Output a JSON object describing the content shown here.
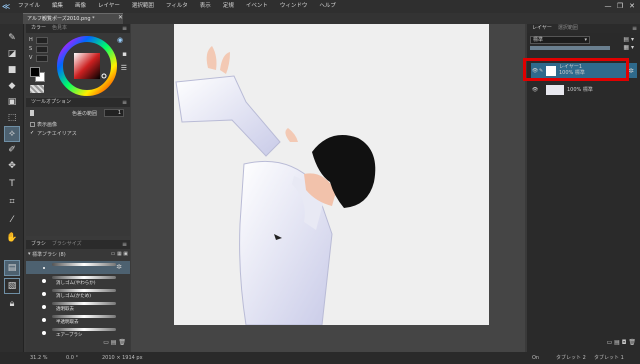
{
  "menu": {
    "items": [
      "ファイル",
      "編集",
      "画像",
      "レイヤー",
      "選択範囲",
      "フィルタ",
      "表示",
      "定規",
      "イベント",
      "ウィンドウ",
      "ヘルプ"
    ],
    "window_controls": [
      "—",
      "❐",
      "✕"
    ]
  },
  "document": {
    "tab_title": "アルフ観覧ポーズ2010.png *"
  },
  "color_panel": {
    "tabs": [
      "カラー",
      "色見本"
    ],
    "labels": [
      "H",
      "S",
      "V"
    ]
  },
  "tool_options": {
    "title": "ツールオプション",
    "tolerance_label": "色差の範囲",
    "tolerance_value": "1",
    "checkboxes": [
      {
        "label": "表示画像",
        "checked": false
      },
      {
        "label": "アンチエイリアス",
        "checked": true
      }
    ]
  },
  "brush_panel": {
    "tabs": [
      "ブラシ",
      "ブラシサイズ"
    ],
    "group_label": "標準ブラシ (8)",
    "brushes": [
      "",
      "消しゴム(やわらか)",
      "消しゴム(かため)",
      "透明取去",
      "半透明取去",
      "エアーブラシ"
    ]
  },
  "layers_panel": {
    "tabs": [
      "レイヤー",
      "選択範囲"
    ],
    "blend_mode": "標準",
    "layers": [
      {
        "name": "レイヤー1",
        "info": "100% 標準",
        "selected": true
      },
      {
        "name": "",
        "info": "100% 標準",
        "selected": false
      }
    ]
  },
  "status": {
    "zoom": "31.2 %",
    "rotation": "0.0 °",
    "size": "2010 × 1914 px",
    "on": "On",
    "tablet_label": "タブレット 2",
    "tablet_mode": "タブレット 1"
  },
  "colors": {
    "accent": "#4d6170",
    "selected_layer": "#2f6a8c",
    "highlight": "#e00000"
  }
}
